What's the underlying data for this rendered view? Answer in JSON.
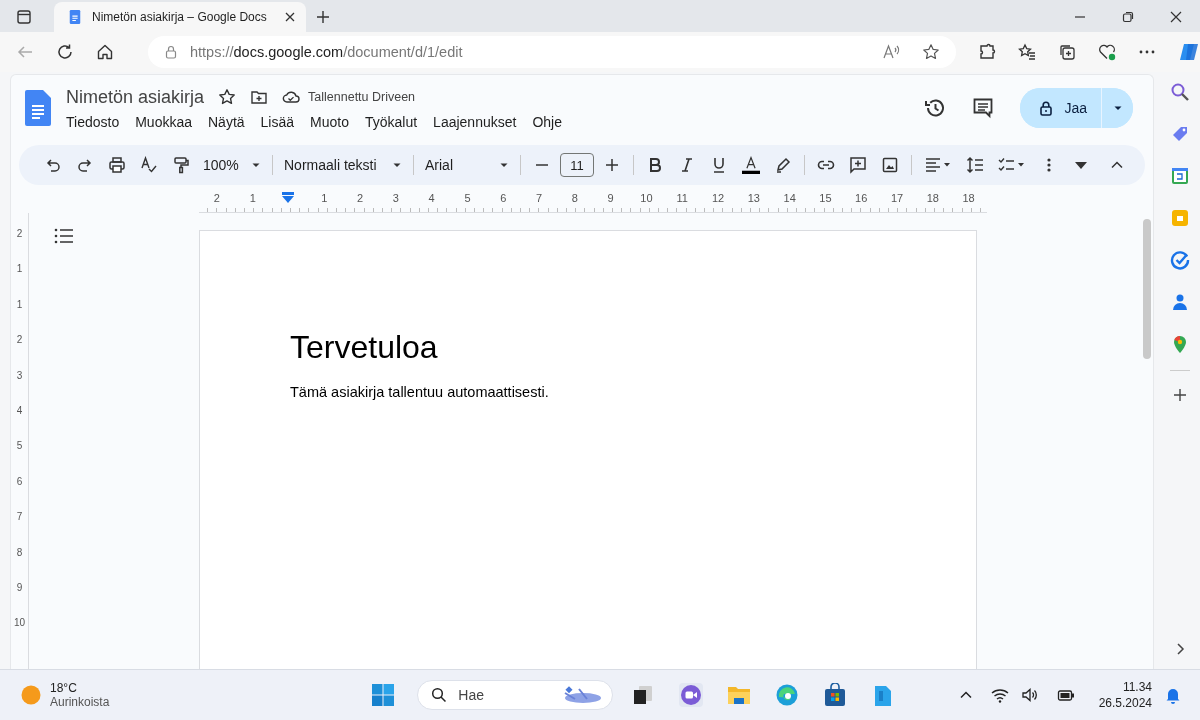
{
  "browser": {
    "tab_title": "Nimetön asiakirja – Google Docs",
    "url_prefix": "https://",
    "url_domain": "docs.google.com",
    "url_path": "/document/d/1/edit"
  },
  "docs": {
    "title": "Nimetön asiakirja",
    "save_status": "Tallennettu Driveen",
    "share_label": "Jaa",
    "menus": [
      "Tiedosto",
      "Muokkaa",
      "Näytä",
      "Lisää",
      "Muoto",
      "Työkalut",
      "Laajennukset",
      "Ohje"
    ]
  },
  "toolbar": {
    "zoom": "100%",
    "paragraph_style": "Normaali teksti",
    "font": "Arial",
    "font_size": "11"
  },
  "ruler": {
    "labels_before_indent": [
      "2",
      "1"
    ],
    "horizontal_labels": [
      "1",
      "2",
      "3",
      "4",
      "5",
      "6",
      "7",
      "8",
      "9",
      "10",
      "11",
      "12",
      "13",
      "14",
      "15",
      "16",
      "17",
      "18",
      "18"
    ],
    "vertical_labels": [
      "2",
      "1",
      "1",
      "2",
      "3",
      "4",
      "5",
      "6",
      "7",
      "8",
      "9",
      "10"
    ]
  },
  "document": {
    "heading": "Tervetuloa",
    "body": "Tämä asiakirja tallentuu automaattisesti."
  },
  "taskbar": {
    "temperature": "18°C",
    "weather": "Aurinkoista",
    "search_placeholder": "Hae",
    "time": "11.34",
    "date": "26.5.2024"
  }
}
